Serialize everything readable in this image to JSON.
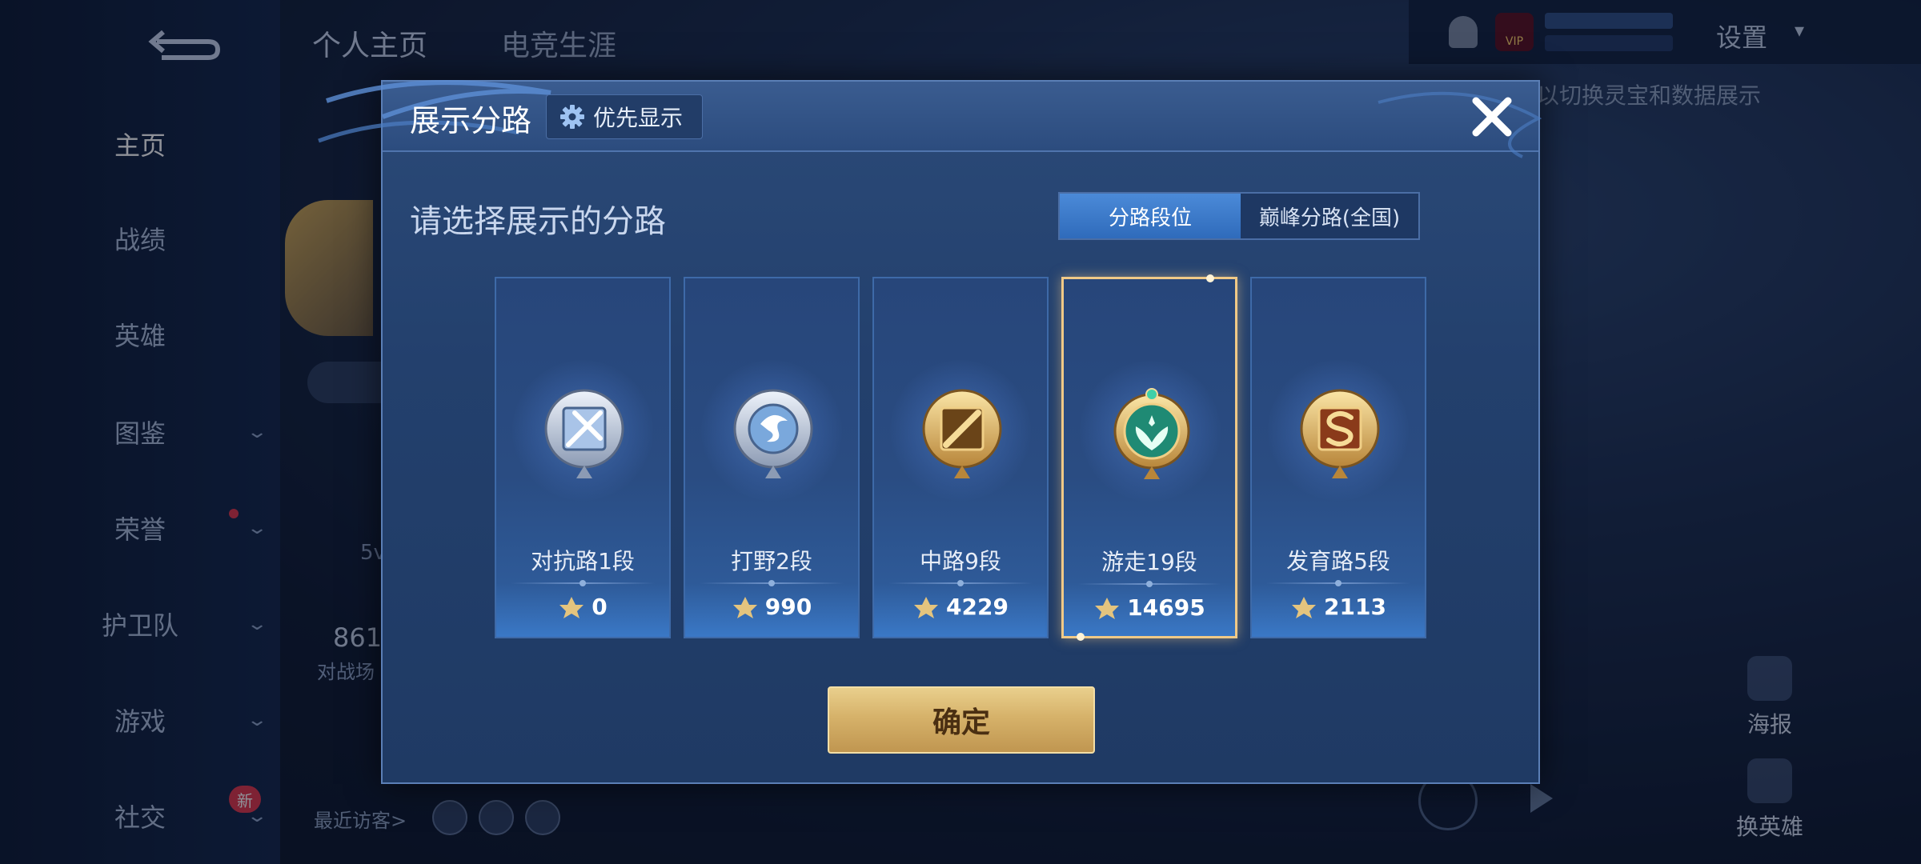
{
  "nav": {
    "items": [
      {
        "label": "主页",
        "active": true
      },
      {
        "label": "战绩"
      },
      {
        "label": "英雄"
      },
      {
        "label": "图鉴",
        "has_chevron": true
      },
      {
        "label": "荣誉",
        "has_chevron": true
      },
      {
        "label": "护卫队",
        "has_chevron": true
      },
      {
        "label": "游戏",
        "has_chevron": true
      },
      {
        "label": "社交",
        "has_chevron": true,
        "badge": "新"
      }
    ]
  },
  "top_tabs": [
    "个人主页",
    "电竞生涯"
  ],
  "top_bar": {
    "settings_label": "设置",
    "vip_label": "VIP"
  },
  "background": {
    "hint_text": "以切换灵宝和数据展示",
    "profile_stat": "861",
    "profile_stat_sub": "对战场",
    "profile_5v": "5v",
    "recent_visitors_label": "最近访客>",
    "poster_label": "海报",
    "switch_hero_label": "换英雄"
  },
  "modal": {
    "title": "展示分路",
    "pref_button_label": "优先显示",
    "subtitle": "请选择展示的分路",
    "toggle": {
      "active": "分路段位",
      "inactive": "巅峰分路(全国)"
    },
    "confirm_label": "确定",
    "lanes": [
      {
        "rank": "对抗路1段",
        "score": "0",
        "emblem": "clash-lane-emblem",
        "tier": "silver"
      },
      {
        "rank": "打野2段",
        "score": "990",
        "emblem": "jungle-emblem",
        "tier": "silver"
      },
      {
        "rank": "中路9段",
        "score": "4229",
        "emblem": "mid-lane-emblem",
        "tier": "gold"
      },
      {
        "rank": "游走19段",
        "score": "14695",
        "emblem": "roam-emblem",
        "tier": "jade",
        "selected": true
      },
      {
        "rank": "发育路5段",
        "score": "2113",
        "emblem": "farm-lane-emblem",
        "tier": "gold"
      }
    ]
  },
  "colors": {
    "accent_gold": "#e9cf8c",
    "selected_border": "#f0c987",
    "toggle_active": "#3a7bcc",
    "modal_bg": "#23406d"
  }
}
